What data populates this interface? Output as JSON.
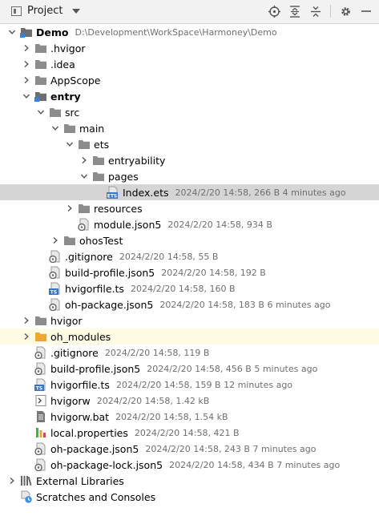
{
  "toolbar": {
    "title": "Project",
    "buttons": [
      {
        "name": "locate-icon"
      },
      {
        "name": "expand-all-icon"
      },
      {
        "name": "collapse-all-icon"
      },
      {
        "name": "settings-icon"
      },
      {
        "name": "hide-icon"
      }
    ]
  },
  "tree": [
    {
      "label": "Demo",
      "meta": "D:\\Development\\WorkSpace\\Harmoney\\Demo",
      "depth": 0,
      "arrow": "down",
      "icon": "module-folder-icon",
      "bold": true
    },
    {
      "label": ".hvigor",
      "meta": "",
      "depth": 1,
      "arrow": "right",
      "icon": "folder-icon"
    },
    {
      "label": ".idea",
      "meta": "",
      "depth": 1,
      "arrow": "right",
      "icon": "folder-icon"
    },
    {
      "label": "AppScope",
      "meta": "",
      "depth": 1,
      "arrow": "right",
      "icon": "folder-icon"
    },
    {
      "label": "entry",
      "meta": "",
      "depth": 1,
      "arrow": "down",
      "icon": "module-folder-icon",
      "bold": true
    },
    {
      "label": "src",
      "meta": "",
      "depth": 2,
      "arrow": "down",
      "icon": "folder-icon"
    },
    {
      "label": "main",
      "meta": "",
      "depth": 3,
      "arrow": "down",
      "icon": "folder-icon"
    },
    {
      "label": "ets",
      "meta": "",
      "depth": 4,
      "arrow": "down",
      "icon": "folder-icon"
    },
    {
      "label": "entryability",
      "meta": "",
      "depth": 5,
      "arrow": "right",
      "icon": "folder-icon"
    },
    {
      "label": "pages",
      "meta": "",
      "depth": 5,
      "arrow": "down",
      "icon": "folder-icon"
    },
    {
      "label": "Index.ets",
      "meta": "2024/2/20 14:58, 266 B 4 minutes ago",
      "depth": 6,
      "arrow": "none",
      "icon": "ets-file-icon",
      "selected": true
    },
    {
      "label": "resources",
      "meta": "",
      "depth": 4,
      "arrow": "right",
      "icon": "folder-icon"
    },
    {
      "label": "module.json5",
      "meta": "2024/2/20 14:58, 934 B",
      "depth": 4,
      "arrow": "none",
      "icon": "json-file-icon"
    },
    {
      "label": "ohosTest",
      "meta": "",
      "depth": 3,
      "arrow": "right",
      "icon": "folder-icon"
    },
    {
      "label": ".gitignore",
      "meta": "2024/2/20 14:58, 55 B",
      "depth": 2,
      "arrow": "none",
      "icon": "config-file-icon"
    },
    {
      "label": "build-profile.json5",
      "meta": "2024/2/20 14:58, 192 B",
      "depth": 2,
      "arrow": "none",
      "icon": "json-file-icon"
    },
    {
      "label": "hvigorfile.ts",
      "meta": "2024/2/20 14:58, 160 B",
      "depth": 2,
      "arrow": "none",
      "icon": "ts-file-icon"
    },
    {
      "label": "oh-package.json5",
      "meta": "2024/2/20 14:58, 183 B 6 minutes ago",
      "depth": 2,
      "arrow": "none",
      "icon": "json-file-icon"
    },
    {
      "label": "hvigor",
      "meta": "",
      "depth": 1,
      "arrow": "right",
      "icon": "folder-icon"
    },
    {
      "label": "oh_modules",
      "meta": "",
      "depth": 1,
      "arrow": "right",
      "icon": "excluded-folder-icon",
      "excluded": true
    },
    {
      "label": ".gitignore",
      "meta": "2024/2/20 14:58, 119 B",
      "depth": 1,
      "arrow": "none",
      "icon": "config-file-icon"
    },
    {
      "label": "build-profile.json5",
      "meta": "2024/2/20 14:58, 456 B 5 minutes ago",
      "depth": 1,
      "arrow": "none",
      "icon": "json-file-icon"
    },
    {
      "label": "hvigorfile.ts",
      "meta": "2024/2/20 14:58, 159 B 12 minutes ago",
      "depth": 1,
      "arrow": "none",
      "icon": "ts-file-icon"
    },
    {
      "label": "hvigorw",
      "meta": "2024/2/20 14:58, 1.42 kB",
      "depth": 1,
      "arrow": "none",
      "icon": "shell-file-icon"
    },
    {
      "label": "hvigorw.bat",
      "meta": "2024/2/20 14:58, 1.54 kB",
      "depth": 1,
      "arrow": "none",
      "icon": "text-file-icon"
    },
    {
      "label": "local.properties",
      "meta": "2024/2/20 14:58, 421 B",
      "depth": 1,
      "arrow": "none",
      "icon": "properties-file-icon"
    },
    {
      "label": "oh-package.json5",
      "meta": "2024/2/20 14:58, 243 B 7 minutes ago",
      "depth": 1,
      "arrow": "none",
      "icon": "json-file-icon"
    },
    {
      "label": "oh-package-lock.json5",
      "meta": "2024/2/20 14:58, 434 B 7 minutes ago",
      "depth": 1,
      "arrow": "none",
      "icon": "json-file-icon"
    },
    {
      "label": "External Libraries",
      "meta": "",
      "depth": 0,
      "arrow": "right",
      "icon": "libraries-icon"
    },
    {
      "label": "Scratches and Consoles",
      "meta": "",
      "depth": 0,
      "arrow": "none",
      "icon": "scratches-icon"
    }
  ],
  "colors": {
    "folder": "#8c8c8c",
    "module_folder": "#6e6e6e",
    "module_badge": "#3c7fd6",
    "excluded_folder": "#f0a732",
    "ets_badge": "#3876c2",
    "ts_badge": "#3876c2",
    "selected_bg": "#d5d5d5",
    "excluded_bg": "#fdfbe4"
  }
}
